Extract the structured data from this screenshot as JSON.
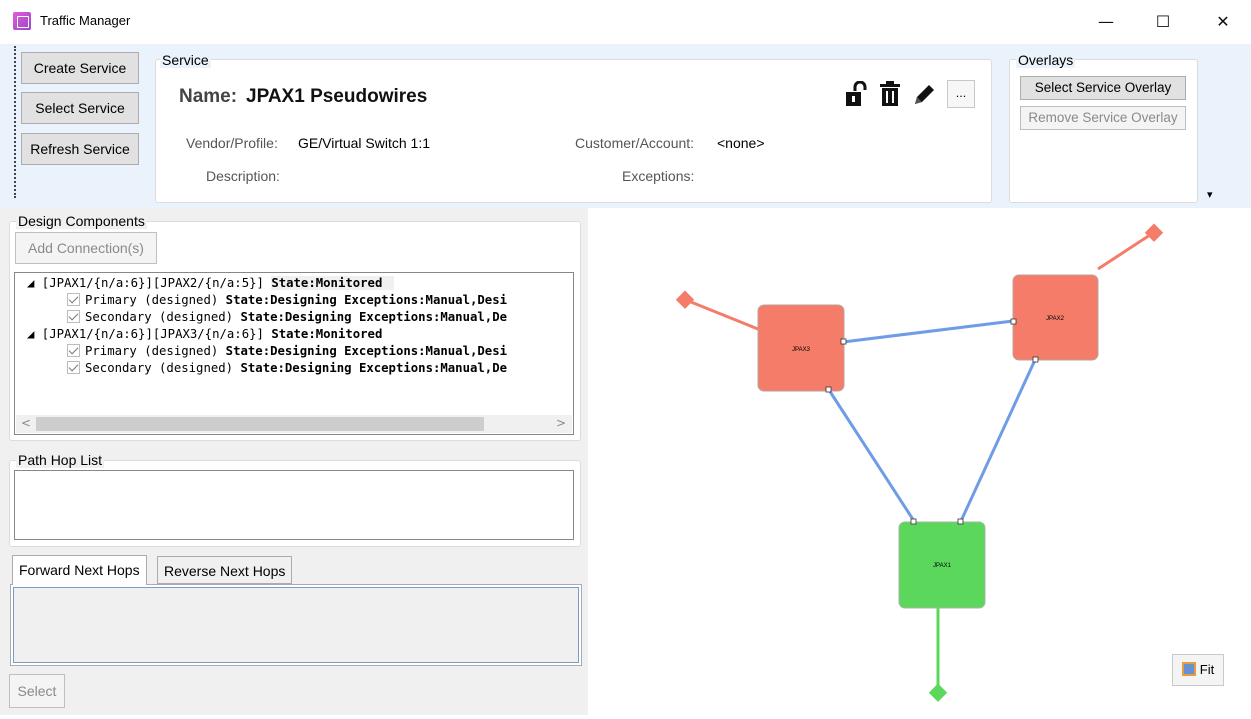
{
  "window": {
    "title": "Traffic Manager",
    "controls": {
      "minimize": "—",
      "maximize": "☐",
      "close": "✕"
    }
  },
  "toolbar": {
    "create_service": "Create Service",
    "select_service": "Select Service",
    "refresh_service": "Refresh Service"
  },
  "service": {
    "group_title": "Service",
    "name_label": "Name:",
    "name_value": "JPAX1 Pseudowires",
    "vendor_label": "Vendor/Profile:",
    "vendor_value": "GE/Virtual Switch 1:1",
    "customer_label": "Customer/Account:",
    "customer_value": "<none>",
    "description_label": "Description:",
    "exceptions_label": "Exceptions:",
    "more_button": "...",
    "icons": [
      "unlock-icon",
      "trash-icon",
      "pencil-icon"
    ]
  },
  "overlays": {
    "group_title": "Overlays",
    "select_overlay": "Select Service Overlay",
    "remove_overlay": "Remove Service Overlay",
    "dropdown_arrow": "▾"
  },
  "design_components": {
    "group_title": "Design Components",
    "add_connection": "Add Connection(s)",
    "tree": [
      {
        "prefix": "◢ [JPAX1/{n/a:6}][JPAX2/{n/a:5}] ",
        "state": "State:Monitored",
        "indent": 0,
        "checked": false
      },
      {
        "prefix": "Primary (designed) ",
        "state": "State:Designing Exceptions:Manual,Desi",
        "indent": 1,
        "checked": true
      },
      {
        "prefix": "Secondary (designed) ",
        "state": "State:Designing Exceptions:Manual,De",
        "indent": 1,
        "checked": true
      },
      {
        "prefix": "◢ [JPAX1/{n/a:6}][JPAX3/{n/a:6}] ",
        "state": "State:Monitored",
        "indent": 0,
        "checked": false
      },
      {
        "prefix": "Primary (designed) ",
        "state": "State:Designing Exceptions:Manual,Desi",
        "indent": 1,
        "checked": true
      },
      {
        "prefix": "Secondary (designed) ",
        "state": "State:Designing Exceptions:Manual,De",
        "indent": 1,
        "checked": true
      }
    ],
    "scroll_left": "<",
    "scroll_right": ">"
  },
  "path_hop": {
    "group_title": "Path Hop List"
  },
  "tabs": {
    "forward": "Forward Next Hops",
    "reverse": "Reverse Next Hops"
  },
  "bottom": {
    "select_button": "Select"
  },
  "diagram": {
    "nodes": [
      {
        "id": "JPAX3",
        "label": "JPAX3",
        "color": "#f47c68"
      },
      {
        "id": "JPAX2",
        "label": "JPAX2",
        "color": "#f47c68"
      },
      {
        "id": "JPAX1",
        "label": "JPAX1",
        "color": "#5bd85b"
      }
    ],
    "link_color": "#6f9ce6",
    "fit_button": "Fit"
  }
}
